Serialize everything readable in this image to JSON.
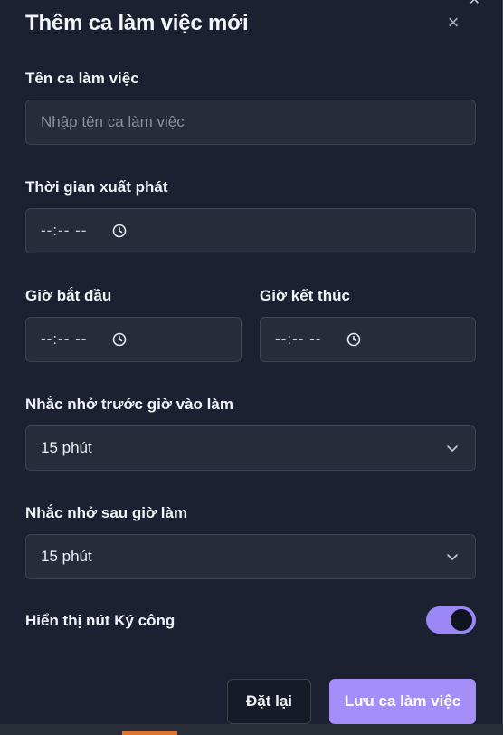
{
  "dialog": {
    "title": "Thêm ca làm việc mới",
    "close_glyph": "×"
  },
  "form": {
    "name_label": "Tên ca làm việc",
    "name_placeholder": "Nhập tên ca làm việc",
    "departure_label": "Thời gian xuất phát",
    "departure_value": "--:-- --",
    "start_label": "Giờ bắt đầu",
    "start_value": "--:-- --",
    "end_label": "Giờ kết thúc",
    "end_value": "--:-- --",
    "remind_before_label": "Nhắc nhở trước giờ vào làm",
    "remind_before_value": "15 phút",
    "remind_after_label": "Nhắc nhở sau giờ làm",
    "remind_after_value": "15 phút",
    "show_sign_button_label": "Hiển thị nút Ký công",
    "show_sign_button_on": true
  },
  "actions": {
    "reset_label": "Đặt lại",
    "save_label": "Lưu ca làm việc"
  },
  "icons": {
    "close": "close-icon",
    "clock": "clock-icon",
    "chevron": "chevron-down-icon"
  },
  "colors": {
    "background": "#1b2130",
    "field": "#262c3a",
    "accent": "#a48ef7"
  }
}
